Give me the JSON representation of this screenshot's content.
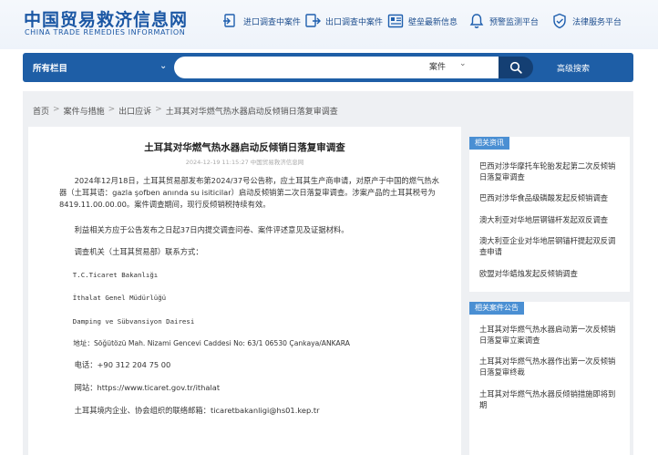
{
  "header": {
    "logo_cn": "中国贸易救济信息网",
    "logo_en": "CHINA TRADE REMEDIES INFORMATION",
    "nav": [
      {
        "label": "进口调查中案件",
        "icon": "import-document-icon"
      },
      {
        "label": "出口调查中案件",
        "icon": "export-document-icon"
      },
      {
        "label": "壁垒最新信息",
        "icon": "news-board-icon"
      },
      {
        "label": "预警监测平台",
        "icon": "bell-icon"
      },
      {
        "label": "法律服务平台",
        "icon": "shield-check-icon"
      }
    ]
  },
  "search": {
    "all_columns": "所有栏目",
    "placeholder": "",
    "value": "",
    "type_select": "案件",
    "advanced": "高级搜索"
  },
  "breadcrumb": [
    "首页",
    "案件与措施",
    "出口应诉",
    "土耳其对华燃气热水器启动反倾销日落复审调查"
  ],
  "article": {
    "title": "土耳其对华燃气热水器启动反倾销日落复审调查",
    "meta": "2024-12-19 11:15:27 中国贸易救济信息网",
    "paragraphs": [
      "2024年12月18日，土耳其贸易部发布第2024/37号公告称，应土耳其生产商申请，对原产于中国的燃气热水器（土耳其语：gazla şofben anında su isiticilar）启动反倾销第二次日落复审调查。涉案产品的土耳其税号为8419.11.00.00.00。案件调查期间，现行反倾销税持续有效。",
      "利益相关方应于公告发布之日起37日内提交调查问卷、案件评述意见及证据材料。",
      "调查机关（土耳其贸易部）联系方式：",
      "T.C.Ticaret Bakanlığı",
      "İthalat Genel Müdürlüğü",
      "Damping ve Sübvansiyon Dairesi",
      "地址：Söğütözü Mah. Nizami Gencevi Caddesi No: 63/1 06530 Çankaya/ANKARA",
      "电话：+90 312 204 75 00",
      "网站：https://www.ticaret.gov.tr/ithalat",
      "土耳其境内企业、协会组织的联络邮箱：ticaretbakanligi@hs01.kep.tr"
    ]
  },
  "related_news": {
    "heading": "相关资讯",
    "items": [
      "巴西对涉华摩托车轮胎发起第二次反倾销日落复审调查",
      "巴西对涉华食品级磷酸发起反倾销调查",
      "澳大利亚对华地层钢锚杆发起双反调查",
      "澳大利亚企业对华地层钢锚杆提起双反调查申请",
      "欧盟对华蜡烛发起反倾销调查"
    ]
  },
  "related_cases": {
    "heading": "相关案件公告",
    "items": [
      "土耳其对华燃气热水器启动第一次反倾销日落复审立案调查",
      "土耳其对华燃气热水器作出第一次反倾销日落复审终裁",
      "土耳其对华燃气热水器反倾销措施即将到期"
    ]
  },
  "colors": {
    "brand_blue": "#1b57a4",
    "search_bar": "#1e5ea6",
    "side_heading": "#4a8fd3"
  }
}
